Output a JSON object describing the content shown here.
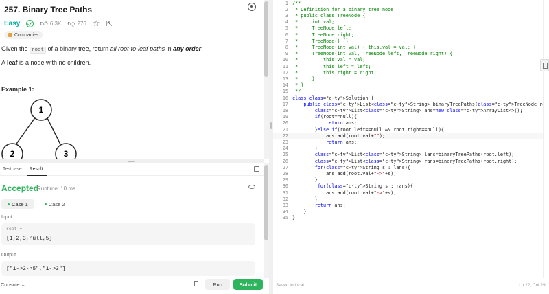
{
  "problem": {
    "title": "257. Binary Tree Paths",
    "difficulty": "Easy",
    "likes": "6.3K",
    "dislikes": "276",
    "companies_label": "Companies",
    "desc_pre": "Given the ",
    "desc_code": "root",
    "desc_mid": " of a binary tree, return ",
    "desc_em1": "all root-to-leaf paths",
    "desc_in": " in ",
    "desc_em2": "any order",
    "desc_end": ".",
    "leaf_pre": "A ",
    "leaf_word": "leaf",
    "leaf_post": " is a node with no children.",
    "example_title": "Example 1:",
    "tree_nodes": [
      "1",
      "2",
      "3"
    ]
  },
  "results": {
    "tabs": [
      "Testcase",
      "Result"
    ],
    "status": "Accepted",
    "runtime": "Runtime: 10 ms",
    "cases": [
      "Case 1",
      "Case 2"
    ],
    "input_label": "Input",
    "input_var": "root =",
    "input_value": "[1,2,3,null,5]",
    "output_label": "Output",
    "output_value": "[\"1->2->5\",\"1->3\"]"
  },
  "footer": {
    "console": "Console",
    "run": "Run",
    "submit": "Submit"
  },
  "editor": {
    "lines": [
      "/**",
      " * Definition for a binary tree node.",
      " * public class TreeNode {",
      " *     int val;",
      " *     TreeNode left;",
      " *     TreeNode right;",
      " *     TreeNode() {}",
      " *     TreeNode(int val) { this.val = val; }",
      " *     TreeNode(int val, TreeNode left, TreeNode right) {",
      " *         this.val = val;",
      " *         this.left = left;",
      " *         this.right = right;",
      " *     }",
      " * }",
      " */",
      "class Solution {",
      "    public List<String> binaryTreePaths(TreeNode root) {",
      "        List<String> ans=new ArrayList<>();",
      "        if(root==null){",
      "            return ans;",
      "        }else if(root.left==null && root.right==null){",
      "            ans.add(root.val+\"\");",
      "            return ans;",
      "        }",
      "        List<String> lans=binaryTreePaths(root.left);",
      "        List<String> rans=binaryTreePaths(root.right);",
      "        for(String s : lans){",
      "            ans.add(root.val+\"->\"+s);",
      "        }",
      "         for(String s : rans){",
      "            ans.add(root.val+\"->\"+s);",
      "        }",
      "        return ans;",
      "    }",
      "}"
    ],
    "highlight_line": 22,
    "saved": "Saved to local",
    "cursor": "Ln 22, Col 29"
  },
  "colors": {
    "accent_green": "#2db55d",
    "easy": "#00af9b",
    "comment": "#008000",
    "keyword": "#0000ff",
    "type": "#267f99",
    "string": "#a31515"
  },
  "icons": [
    "check-circle-icon",
    "thumbs-up-icon",
    "thumbs-down-icon",
    "star-icon",
    "share-icon",
    "gear-icon",
    "tag-icon",
    "eye-icon",
    "trash-icon",
    "expand-icon",
    "chevron-down-icon",
    "file-icon"
  ]
}
